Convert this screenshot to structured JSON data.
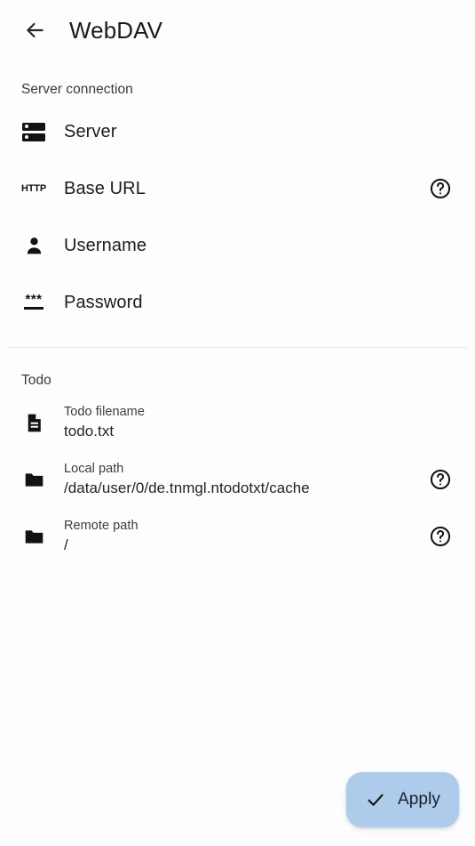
{
  "appbar": {
    "back_icon": "arrow-back-icon",
    "title": "WebDAV"
  },
  "sections": [
    {
      "id": "server-connection",
      "header": "Server connection",
      "items": [
        {
          "id": "server",
          "icon": "server-icon",
          "title": "Server",
          "subtitle": null,
          "help": false
        },
        {
          "id": "base-url",
          "icon": "http-icon",
          "title": "Base URL",
          "subtitle": null,
          "help": true
        },
        {
          "id": "username",
          "icon": "person-icon",
          "title": "Username",
          "subtitle": null,
          "help": false
        },
        {
          "id": "password",
          "icon": "password-icon",
          "title": "Password",
          "subtitle": null,
          "help": false
        }
      ]
    },
    {
      "id": "todo",
      "header": "Todo",
      "items": [
        {
          "id": "todo-filename",
          "icon": "document-icon",
          "title": "Todo filename",
          "subtitle": "todo.txt",
          "help": false
        },
        {
          "id": "local-path",
          "icon": "folder-icon",
          "title": "Local path",
          "subtitle": "/data/user/0/de.tnmgl.ntodotxt/cache",
          "help": true
        },
        {
          "id": "remote-path",
          "icon": "folder-icon",
          "title": "Remote path",
          "subtitle": "/",
          "help": true
        }
      ]
    }
  ],
  "help_icon": "help-circle-icon",
  "fab": {
    "icon": "check-icon",
    "label": "Apply"
  },
  "colors": {
    "background": "#fdfdfd",
    "fab_background": "#aecbeb",
    "icon": "#121212",
    "divider": "#e4e4e6",
    "primary_text": "#1c1c1c",
    "secondary_text": "#3a3a3a"
  }
}
